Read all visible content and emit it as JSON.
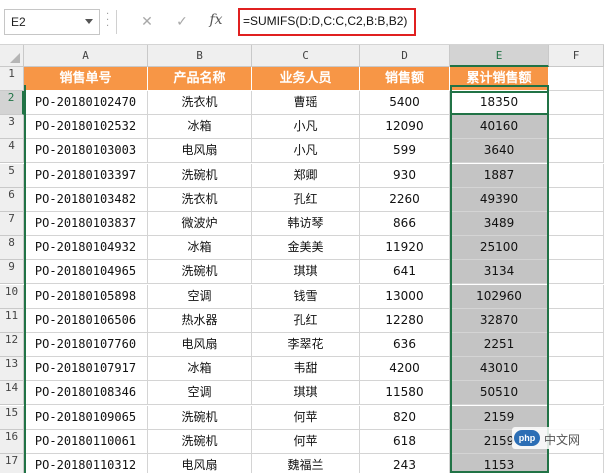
{
  "formula_bar": {
    "name_box": "E2",
    "cancel_icon": "✕",
    "enter_icon": "✓",
    "fx_icon": "fx",
    "formula": "=SUMIFS(D:D,C:C,C2,B:B,B2)"
  },
  "columns": [
    "A",
    "B",
    "C",
    "D",
    "E",
    "F"
  ],
  "header": [
    "销售单号",
    "产品名称",
    "业务人员",
    "销售额",
    "累计销售额"
  ],
  "rows": [
    {
      "n": "2",
      "a": "PO-20180102470",
      "b": "洗衣机",
      "c": "曹瑶",
      "d": "5400",
      "e": "18350"
    },
    {
      "n": "3",
      "a": "PO-20180102532",
      "b": "冰箱",
      "c": "小凡",
      "d": "12090",
      "e": "40160"
    },
    {
      "n": "4",
      "a": "PO-20180103003",
      "b": "电风扇",
      "c": "小凡",
      "d": "599",
      "e": "3640"
    },
    {
      "n": "5",
      "a": "PO-20180103397",
      "b": "洗碗机",
      "c": "郑卿",
      "d": "930",
      "e": "1887"
    },
    {
      "n": "6",
      "a": "PO-20180103482",
      "b": "洗衣机",
      "c": "孔红",
      "d": "2260",
      "e": "49390"
    },
    {
      "n": "7",
      "a": "PO-20180103837",
      "b": "微波炉",
      "c": "韩访琴",
      "d": "866",
      "e": "3489"
    },
    {
      "n": "8",
      "a": "PO-20180104932",
      "b": "冰箱",
      "c": "金美美",
      "d": "11920",
      "e": "25100"
    },
    {
      "n": "9",
      "a": "PO-20180104965",
      "b": "洗碗机",
      "c": "琪琪",
      "d": "641",
      "e": "3134"
    },
    {
      "n": "10",
      "a": "PO-20180105898",
      "b": "空调",
      "c": "钱雪",
      "d": "13000",
      "e": "102960"
    },
    {
      "n": "11",
      "a": "PO-20180106506",
      "b": "热水器",
      "c": "孔红",
      "d": "12280",
      "e": "32870"
    },
    {
      "n": "12",
      "a": "PO-20180107760",
      "b": "电风扇",
      "c": "李翠花",
      "d": "636",
      "e": "2251"
    },
    {
      "n": "13",
      "a": "PO-20180107917",
      "b": "冰箱",
      "c": "韦甜",
      "d": "4200",
      "e": "43010"
    },
    {
      "n": "14",
      "a": "PO-20180108346",
      "b": "空调",
      "c": "琪琪",
      "d": "11580",
      "e": "50510"
    },
    {
      "n": "15",
      "a": "PO-20180109065",
      "b": "洗碗机",
      "c": "何苹",
      "d": "820",
      "e": "2159"
    },
    {
      "n": "16",
      "a": "PO-20180110061",
      "b": "洗碗机",
      "c": "何苹",
      "d": "618",
      "e": "2159"
    },
    {
      "n": "17",
      "a": "PO-20180110312",
      "b": "电风扇",
      "c": "魏福兰",
      "d": "243",
      "e": "1153"
    }
  ],
  "watermark": {
    "logo": "php",
    "text": "中文网"
  },
  "colors": {
    "header_orange": "#f79646",
    "selection_green": "#217346",
    "fill_gray": "#c4c4c4",
    "formula_border": "#e02020"
  }
}
